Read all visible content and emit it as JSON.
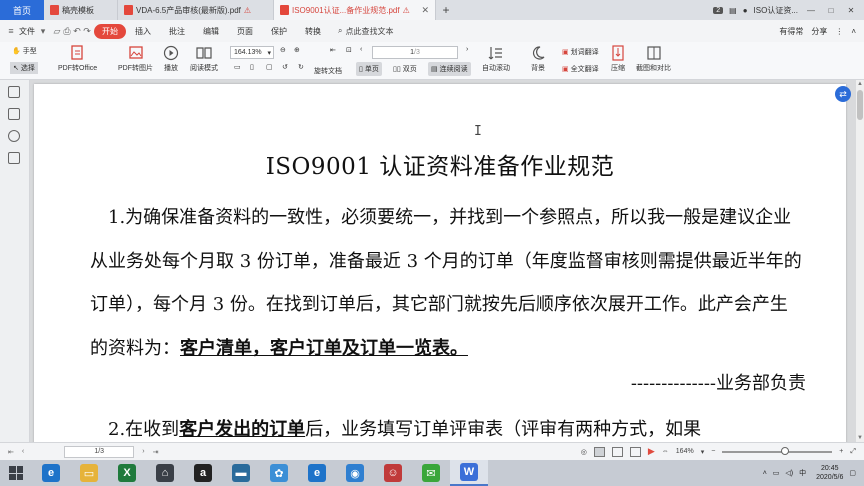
{
  "tabs": {
    "home": "首页",
    "items": [
      {
        "label": "稿壳模板",
        "color": "#e4483c"
      },
      {
        "label": "VDA-6.5产品审核(最新版).pdf",
        "color": "#e4483c"
      },
      {
        "label": "ISO9001认证...备作业规范.pdf",
        "color": "#e4483c"
      }
    ],
    "add": "+",
    "count_badge": "2",
    "account": "ISO认证资..."
  },
  "menu": {
    "file": "文件",
    "start": "开始",
    "items": [
      "插入",
      "批注",
      "编辑",
      "页面",
      "保护",
      "转换"
    ],
    "search": "点此查找文本",
    "right": [
      "有得常",
      "分享"
    ]
  },
  "ribbon": {
    "hand": "手型",
    "select": "选择",
    "pdf_office": "PDF转Office",
    "pdf_image": "PDF转图片",
    "play": "播放",
    "read_mode": "阅读模式",
    "zoom": "164.13%",
    "page_value": "1",
    "page_total": "/3",
    "rotate": "旋转文档",
    "single": "单页",
    "double": "双页",
    "continuous": "连续阅读",
    "auto_scroll": "自动滚动",
    "background": "背景",
    "word_translate": "划词翻译",
    "full_translate": "全文翻译",
    "compress": "压缩",
    "crop_compare": "截图和对比"
  },
  "document": {
    "title": "ISO9001 认证资料准备作业规范",
    "para1_before": "1.为确保准备资料的一致性，必须要统一，并找到一个参照点，所以我一般是建议企业从业务处每个月取 3 份订单，准备最近 3 个月的订单（年度监督审核则需提供最近半年的订单），每个月 3 份。在找到订单后，其它部门就按先后顺序依次展开工作。此产会产生的资料为：",
    "para1_emph": "客户清单，客户订单及订单一览表。",
    "dept_line": "--------------业务部负责",
    "para2_before": "2.在收到",
    "para2_emph": "客户发出的订单",
    "para2_after": "后，业务填写订单评审表（评审有两种方式，如果"
  },
  "status": {
    "page": "1/3",
    "zoom": "164%",
    "zoom_fraction": 0.58
  },
  "taskbar": {
    "apps": [
      {
        "name": "ie",
        "glyph": "e",
        "color": "#1e73c9"
      },
      {
        "name": "explorer",
        "glyph": "▭",
        "color": "#e6b33a"
      },
      {
        "name": "excel",
        "glyph": "X",
        "color": "#1f7a3c"
      },
      {
        "name": "store",
        "glyph": "⌂",
        "color": "#3a3f47"
      },
      {
        "name": "amazon",
        "glyph": "a",
        "color": "#222"
      },
      {
        "name": "monitor",
        "glyph": "▬",
        "color": "#2a6b9b"
      },
      {
        "name": "cloud",
        "glyph": "✿",
        "color": "#3c8fd6"
      },
      {
        "name": "ie2",
        "glyph": "e",
        "color": "#1e73c9"
      },
      {
        "name": "browser",
        "glyph": "◉",
        "color": "#2f7fd0"
      },
      {
        "name": "avatar",
        "glyph": "☺",
        "color": "#c03a3a"
      },
      {
        "name": "wechat",
        "glyph": "✉",
        "color": "#3aa63a"
      },
      {
        "name": "wps",
        "glyph": "W",
        "color": "#3b6fd8"
      }
    ],
    "time": "20:45",
    "date": "2020/5/6"
  }
}
